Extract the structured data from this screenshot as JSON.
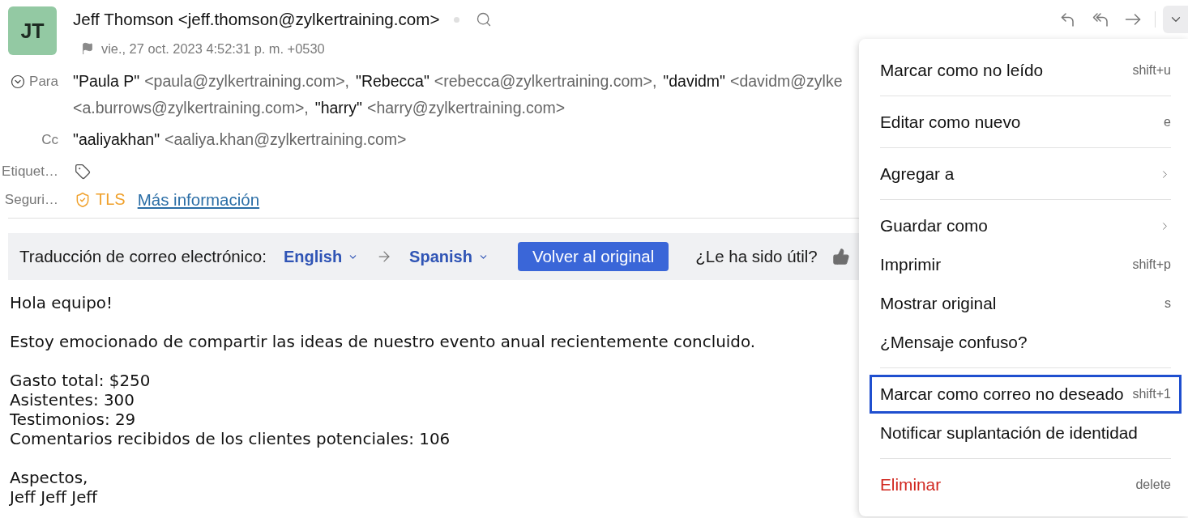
{
  "header": {
    "avatar_initials": "JT",
    "sender": "Jeff Thomson <jeff.thomson@zylkertraining.com>",
    "date": "vie., 27 oct. 2023 4:52:31 p. m. +0530"
  },
  "toolbar": {
    "actions": [
      {
        "kind": "reply"
      },
      {
        "kind": "reply_all"
      },
      {
        "kind": "forward"
      }
    ],
    "more_expanded": true
  },
  "fields": [
    {
      "kind": "to",
      "label": "Para",
      "lines": [
        [
          {
            "name": "\"Paula P\"",
            "address": "<paula@zylkertraining.com>,"
          },
          {
            "name": "\"Rebecca\"",
            "address": "<rebecca@zylkertraining.com>,"
          },
          {
            "name": "\"davidm\"",
            "address": "<davidm@zylke"
          }
        ],
        [
          {
            "address": "<a.burrows@zylkertraining.com>,"
          },
          {
            "name": "\"harry\"",
            "address": "<harry@zylkertraining.com>"
          }
        ]
      ]
    },
    {
      "kind": "cc",
      "label": "Cc",
      "lines": [
        [
          {
            "name": "\"aaliyakhan\"",
            "address": "<aaliya.khan@zylkertraining.com>"
          }
        ]
      ]
    },
    {
      "kind": "tags",
      "label": "Etiquet…"
    },
    {
      "kind": "security",
      "label": "Seguri…",
      "protocol": "TLS",
      "link": "Más información"
    }
  ],
  "translation": {
    "label": "Traducción de correo electrónico:",
    "source": "English",
    "target": "Spanish",
    "button": "Volver al original",
    "feedback": "¿Le ha sido útil?"
  },
  "body": {
    "paragraphs": [
      [
        "Hola equipo!"
      ],
      [
        "Estoy emocionado de compartir las ideas de nuestro evento anual recientemente concluido."
      ],
      [
        "Gasto total: $250",
        "Asistentes: 300",
        "Testimonios: 29",
        "Comentarios recibidos de los clientes potenciales: 106"
      ],
      [
        "Aspectos,",
        "Jeff Jeff Jeff"
      ]
    ]
  },
  "menu": {
    "groups": [
      [
        {
          "label": "Marcar como no leído",
          "shortcut": "shift+u",
          "submenu": false,
          "danger": false,
          "highlighted": false
        }
      ],
      [
        {
          "label": "Editar como nuevo",
          "shortcut": "e",
          "submenu": false,
          "danger": false,
          "highlighted": false
        }
      ],
      [
        {
          "label": "Agregar a",
          "submenu": true,
          "danger": false,
          "highlighted": false
        }
      ],
      [
        {
          "label": "Guardar como",
          "submenu": true,
          "danger": false,
          "highlighted": false
        },
        {
          "label": "Imprimir",
          "shortcut": "shift+p",
          "submenu": false,
          "danger": false,
          "highlighted": false
        },
        {
          "label": "Mostrar original",
          "shortcut": "s",
          "submenu": false,
          "danger": false,
          "highlighted": false
        },
        {
          "label": "¿Mensaje confuso?",
          "submenu": false,
          "danger": false,
          "highlighted": false
        }
      ],
      [
        {
          "label": "Marcar como correo no deseado",
          "shortcut": "shift+1",
          "submenu": false,
          "danger": false,
          "highlighted": true
        },
        {
          "label": "Notificar suplantación de identidad",
          "submenu": false,
          "danger": false,
          "highlighted": false
        }
      ],
      [
        {
          "label": "Eliminar",
          "shortcut": "delete",
          "submenu": false,
          "danger": true,
          "highlighted": false
        }
      ]
    ]
  }
}
